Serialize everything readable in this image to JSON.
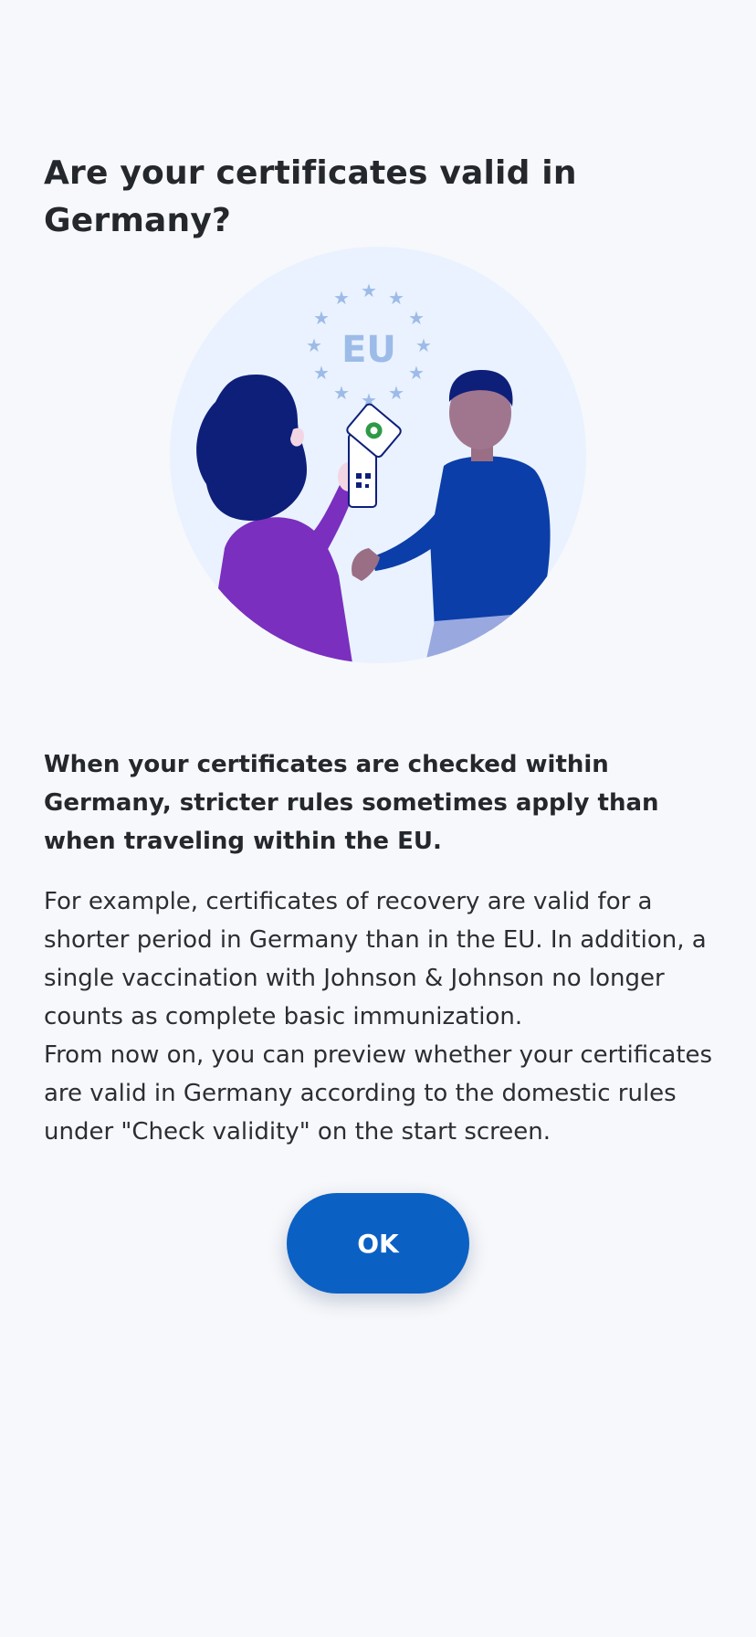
{
  "screen": {
    "title": "Are your certificates valid in Germany?",
    "illustration": {
      "badge_text": "EU",
      "accent_colors": {
        "circle": "#e9f2fe",
        "stars": "#9dbbe8",
        "woman_top": "#7a2fbf",
        "man_shirt": "#0b3ea8",
        "phone_check": "#2e9a46"
      }
    },
    "lead": "When your certificates are checked within Germany, stricter rules sometimes apply than when traveling within the EU.",
    "body": {
      "paragraph_1": "For example, certificates of recovery are valid for a shorter period in Germany than in the EU. In addition, a single vaccination with Johnson & Johnson no longer counts as complete basic immunization.",
      "paragraph_2": "From now on, you can preview whether your certificates are valid in Germany according to the domestic rules under \"Check validity\" on the start screen."
    },
    "ok_button_label": "OK",
    "colors": {
      "background": "#f7f8fb",
      "primary": "#0b60c4",
      "text": "#24272c"
    }
  }
}
